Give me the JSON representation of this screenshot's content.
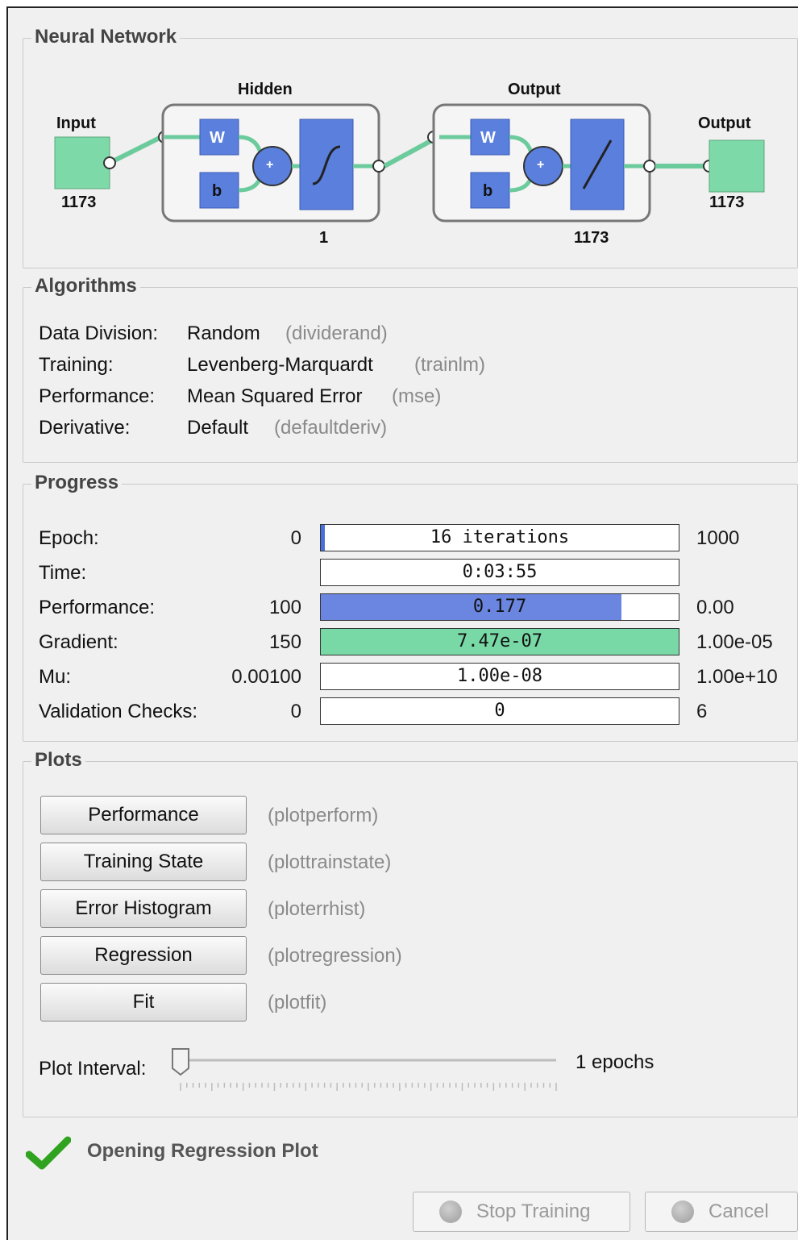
{
  "network": {
    "title": "Neural Network",
    "input_label": "Input",
    "input_size": "1173",
    "hidden_label": "Hidden",
    "hidden_size": "1",
    "output_layer_label": "Output",
    "output_layer_size": "1173",
    "output_label": "Output",
    "output_size": "1173",
    "weight_symbol": "W",
    "bias_symbol": "b",
    "sum_symbol": "+"
  },
  "algorithms": {
    "title": "Algorithms",
    "rows": [
      {
        "label": "Data Division:",
        "value": "Random",
        "func": "(dividerand)"
      },
      {
        "label": "Training:",
        "value": "Levenberg-Marquardt",
        "func": "(trainlm)"
      },
      {
        "label": "Performance:",
        "value": "Mean Squared Error",
        "func": "(mse)"
      },
      {
        "label": "Derivative:",
        "value": "Default",
        "func": "(defaultderiv)"
      }
    ]
  },
  "progress": {
    "title": "Progress",
    "rows": [
      {
        "label": "Epoch:",
        "start": "0",
        "bar_text": "16 iterations",
        "end": "1000",
        "fill": 0.016,
        "fill_color": "#4a6fdc"
      },
      {
        "label": "Time:",
        "start": "",
        "bar_text": "0:03:55",
        "end": "",
        "fill": 0,
        "fill_color": "#ffffff"
      },
      {
        "label": "Performance:",
        "start": "100",
        "bar_text": "0.177",
        "end": "0.00",
        "fill": 0.84,
        "fill_color": "#6b86e0"
      },
      {
        "label": "Gradient:",
        "start": "150",
        "bar_text": "7.47e-07",
        "end": "1.00e-05",
        "fill": 1.0,
        "fill_color": "#79d9a6"
      },
      {
        "label": "Mu:",
        "start": "0.00100",
        "bar_text": "1.00e-08",
        "end": "1.00e+10",
        "fill": 0,
        "fill_color": "#ffffff"
      },
      {
        "label": "Validation Checks:",
        "start": "0",
        "bar_text": "0",
        "end": "6",
        "fill": 0,
        "fill_color": "#ffffff"
      }
    ]
  },
  "plots": {
    "title": "Plots",
    "buttons": [
      {
        "label": "Performance",
        "func": "(plotperform)"
      },
      {
        "label": "Training State",
        "func": "(plottrainstate)"
      },
      {
        "label": "Error Histogram",
        "func": "(ploterrhist)"
      },
      {
        "label": "Regression",
        "func": "(plotregression)"
      },
      {
        "label": "Fit",
        "func": "(plotfit)"
      }
    ],
    "interval_label": "Plot Interval:",
    "interval_value": "1 epochs",
    "interval_level": 0
  },
  "status": {
    "text": "Opening Regression Plot"
  },
  "footer": {
    "stop_label": "Stop Training",
    "cancel_label": "Cancel"
  }
}
